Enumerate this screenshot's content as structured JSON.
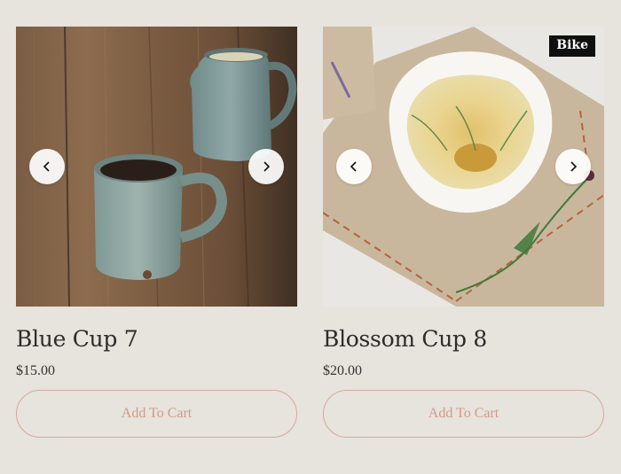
{
  "products": [
    {
      "title": "Blue Cup 7",
      "price": "$15.00",
      "cart_label": "Add To Cart",
      "badge": "",
      "image_subject": "blue ceramic mug and jug on wooden table"
    },
    {
      "title": "Blossom Cup 8",
      "price": "$20.00",
      "cart_label": "Add To Cart",
      "badge": "Bike",
      "image_subject": "white bowl with painted flower on linen coaster"
    }
  ],
  "icons": {
    "prev": "chevron-left-icon",
    "next": "chevron-right-icon"
  },
  "colors": {
    "background": "#e7e3dd",
    "accent": "#d29a88",
    "badge_bg": "#0f0f0f"
  }
}
